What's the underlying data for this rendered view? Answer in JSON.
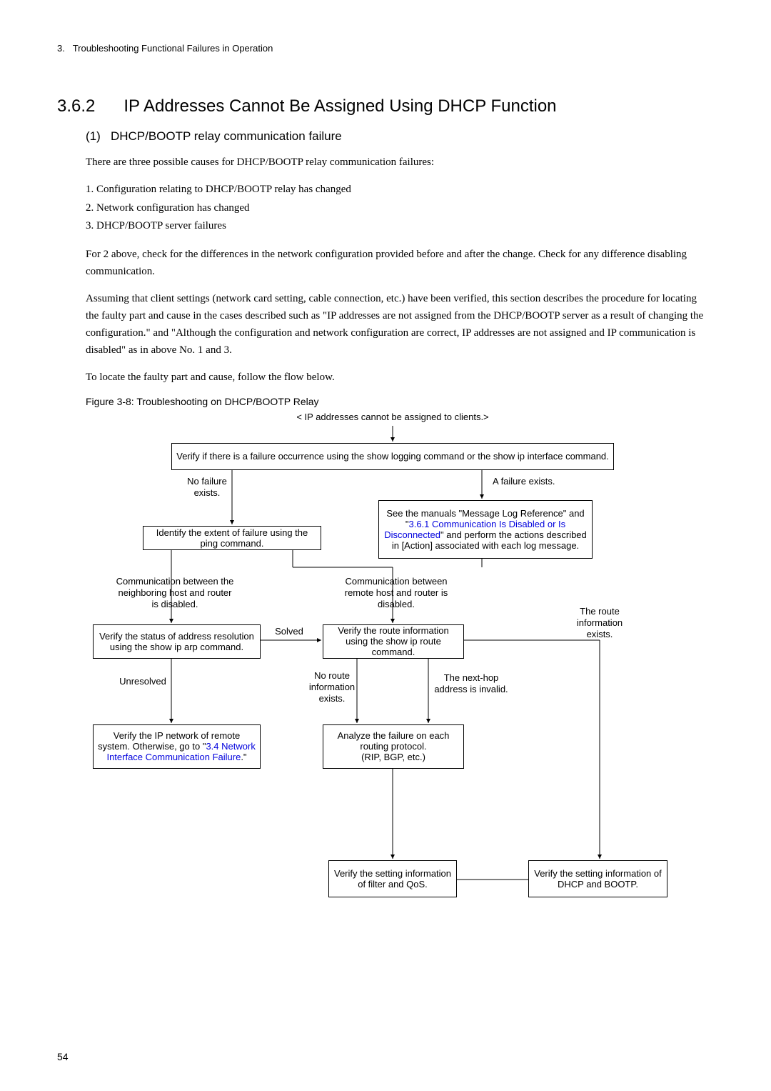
{
  "header": {
    "chapter_num": "3.",
    "chapter_title": "Troubleshooting Functional Failures in Operation"
  },
  "section": {
    "number": "3.6.2",
    "title": "IP Addresses Cannot Be Assigned Using DHCP Function"
  },
  "subsection": {
    "number": "(1)",
    "title": "DHCP/BOOTP relay communication failure"
  },
  "para1": "There are three possible causes for DHCP/BOOTP relay communication failures:",
  "list": {
    "item1": "1.  Configuration relating to DHCP/BOOTP relay has changed",
    "item2": "2.  Network configuration has changed",
    "item3": "3.  DHCP/BOOTP server failures"
  },
  "para2": "For 2 above, check for the differences in the network configuration provided before and after the change. Check for any difference disabling communication.",
  "para3": "Assuming that client settings (network card setting, cable connection, etc.) have been verified, this section describes the procedure for locating the faulty part and cause in the cases described such as \"IP addresses are not assigned from the DHCP/BOOTP server as a result of changing the configuration.\" and \"Although the configuration and network configuration are correct, IP addresses are not assigned and IP communication is disabled\" as in above No. 1 and 3.",
  "para4": "To locate the faulty part and cause, follow the flow below.",
  "figure_caption": "Figure 3-8: Troubleshooting on DHCP/BOOTP Relay",
  "flow": {
    "start": "< IP addresses cannot be assigned to clients.>",
    "box1": "Verify if there is a failure occurrence using the show logging command or the show ip interface command.",
    "label_no_failure": "No failure exists.",
    "label_failure_exists": "A failure exists.",
    "box2": "Identify the extent of failure using the ping command.",
    "box3_pre": "See the manuals \"Message Log Reference\" and \"",
    "box3_link": "3.6.1 Communication Is Disabled or Is Disconnected",
    "box3_post": "\" and perform the actions described in [Action] associated with each log message.",
    "label_comm_neighbor": "Communication between the neighboring host and router is disabled.",
    "label_comm_remote": "Communication between remote host and router is disabled.",
    "label_route_exists": "The route information exists.",
    "box4": "Verify the status of address resolution using the show ip arp command.",
    "label_solved": "Solved",
    "box5": "Verify the route information using the show ip route command.",
    "label_unresolved": "Unresolved",
    "label_no_route": "No route information exists.",
    "label_nexthop": "The next-hop address is invalid.",
    "box6_pre": "Verify the IP network of remote system. Otherwise, go to \"",
    "box6_link": "3.4 Network Interface Communication Failure",
    "box6_post": ".\"",
    "box7": "Analyze the failure on each routing protocol.\n(RIP, BGP, etc.)",
    "box8": "Verify the setting information of filter and QoS.",
    "box9": "Verify the setting information of DHCP and BOOTP."
  },
  "page_number": "54"
}
